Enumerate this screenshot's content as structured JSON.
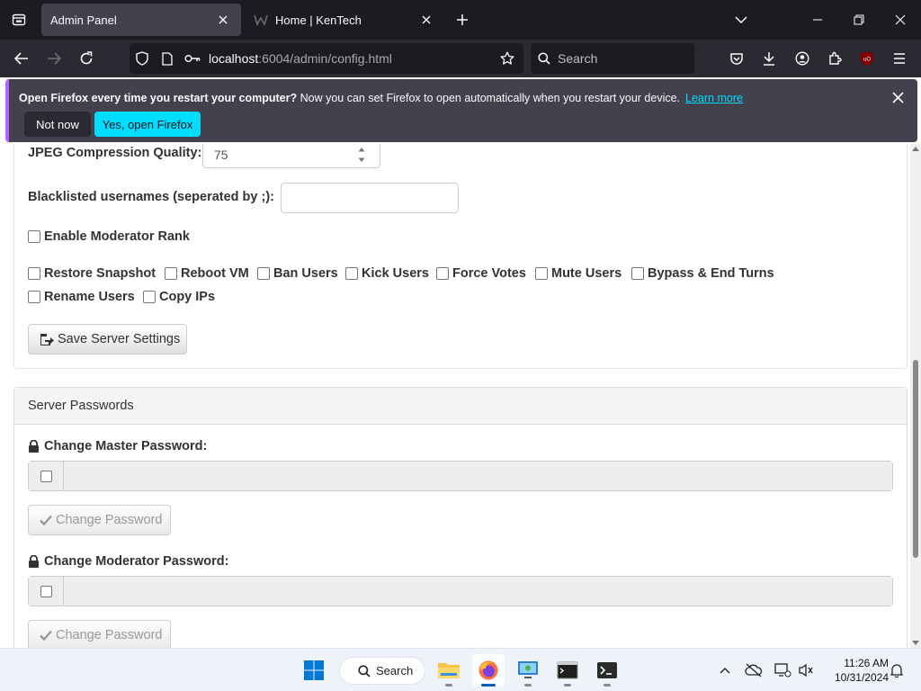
{
  "browser": {
    "tabs": [
      {
        "title": "Admin Panel",
        "active": true
      },
      {
        "title": "Home | KenTech",
        "active": false
      }
    ],
    "url_host": "localhost",
    "url_rest": ":6004/admin/config.html",
    "search_placeholder": "Search"
  },
  "notification": {
    "bold_text": "Open Firefox every time you restart your computer?",
    "text": " Now you can set Firefox to open automatically when you restart your device.",
    "link": "Learn more",
    "not_now": "Not now",
    "yes": "Yes, open Firefox"
  },
  "settings": {
    "jpeg_label": "JPEG Compression Quality:",
    "jpeg_value": "75",
    "blacklist_label": "Blacklisted usernames (seperated by ;):",
    "blacklist_value": "",
    "enable_mod_label": "Enable Moderator Rank",
    "mod_perms": [
      "Restore Snapshot",
      "Reboot VM",
      "Ban Users",
      "Kick Users",
      "Force Votes",
      "Mute Users",
      "Bypass & End Turns",
      "Rename Users",
      "Copy IPs"
    ],
    "save_label": "Save Server Settings"
  },
  "passwords": {
    "panel_title": "Server Passwords",
    "master_label": "Change Master Password:",
    "moderator_label": "Change Moderator Password:",
    "change_label": "Change Password"
  },
  "taskbar": {
    "search_label": "Search",
    "time": "11:26 AM",
    "date": "10/31/2024"
  },
  "colors": {
    "accent_firefox": "#00ddff",
    "notification_bar": "#42414d",
    "win_accent": "#005fb8"
  }
}
